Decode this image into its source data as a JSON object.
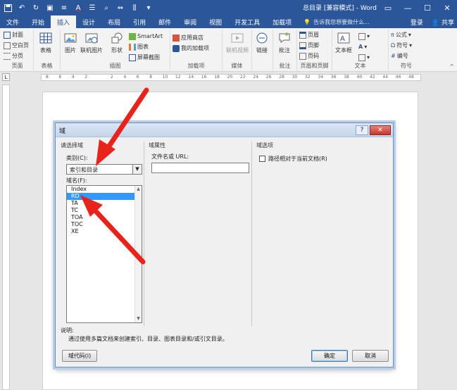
{
  "app": {
    "doc_title": "总目录 [兼容模式] - Word",
    "window_buttons": [
      "—",
      "☐",
      "✕"
    ]
  },
  "tabs": {
    "items": [
      "文件",
      "开始",
      "插入",
      "设计",
      "布局",
      "引用",
      "邮件",
      "审阅",
      "视图",
      "开发工具",
      "加载项"
    ],
    "active": "插入",
    "tell_me": "告诉我您想要做什么...",
    "login": "登录",
    "share": "共享"
  },
  "ribbon": {
    "pages": {
      "cover": "封面",
      "blank": "空白页",
      "break": "分页",
      "label": "页面"
    },
    "table": {
      "table": "表格",
      "label": "表格"
    },
    "illustrations": {
      "picture": "图片",
      "online_picture": "联机图片",
      "shapes": "形状",
      "smartart": "SmartArt",
      "chart": "图表",
      "screenshot": "屏幕截图",
      "label": "插图"
    },
    "addins": {
      "store": "应用商店",
      "my_addins": "我的加载项",
      "label": "加载项"
    },
    "media": {
      "online_video": "联机视频",
      "label": "媒体"
    },
    "links": {
      "link": "链接"
    },
    "comments": {
      "comment": "批注",
      "label": "批注"
    },
    "header_footer": {
      "header": "页眉",
      "footer": "页脚",
      "page_number": "页码",
      "label": "页眉和页脚"
    },
    "text": {
      "textbox": "文本框",
      "label": "文本"
    },
    "symbols": {
      "equation": "公式",
      "symbol": "符号",
      "number": "编号",
      "label": "符号"
    }
  },
  "ruler": {
    "numbers": [
      "8",
      "6",
      "4",
      "2",
      "",
      "2",
      "4",
      "6",
      "8",
      "10",
      "12",
      "14",
      "16",
      "18",
      "20",
      "22",
      "24",
      "26",
      "28",
      "30",
      "32",
      "34",
      "36",
      "38",
      "40",
      "42",
      "44",
      "46",
      "48"
    ]
  },
  "dialog": {
    "title": "域",
    "help": "?",
    "close": "✕",
    "select_section": "请选择域",
    "category_label": "类别(C):",
    "category_value": "索引和目录",
    "names_label": "域名(F):",
    "field_names": [
      "Index",
      "RD",
      "TA",
      "TC",
      "TOA",
      "TOC",
      "XE"
    ],
    "selected_field": "RD",
    "props_section": "域属性",
    "filename_label": "文件名或 URL:",
    "filename_value": "",
    "options_section": "域选项",
    "relative_path_label": "路径相对于当前文档(R)",
    "desc_label": "说明:",
    "desc_text": "通过使用多篇文档来创建索引、目录、图表目录和/或引文目录。",
    "field_codes_button": "域代码(I)",
    "ok_button": "确定",
    "cancel_button": "取消"
  },
  "colors": {
    "accent": "#2b579a",
    "arrow": "#e8231b",
    "selection": "#3399ff"
  }
}
